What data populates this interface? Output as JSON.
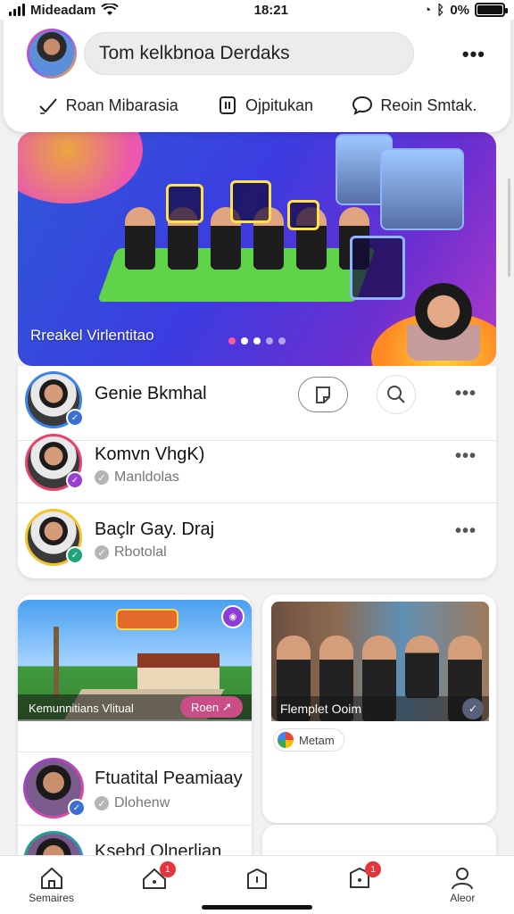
{
  "status_bar": {
    "carrier": "Mideadam",
    "time": "18:21",
    "battery": "0%"
  },
  "header": {
    "search_text": "Tom kelkbnoa Derdaks",
    "actions": [
      {
        "label": "Roan Mibarasia",
        "icon": "check-icon"
      },
      {
        "label": "Ojpitukan",
        "icon": "clipboard-icon"
      },
      {
        "label": "Reoin Smtak.",
        "icon": "chat-bubble-icon"
      }
    ]
  },
  "hero": {
    "caption": "Rreakel Virlentitao"
  },
  "contacts": [
    {
      "name": "Genie Bkmhal",
      "sub": "",
      "ring": "#3b83e6",
      "badge": "#3b6fd6"
    },
    {
      "name": "Komvn VhgK)",
      "sub": "Manldolas",
      "ring": "#e5436a",
      "badge": "#9b3ed6"
    },
    {
      "name": "Baçlr Gay. Draj",
      "sub": "Rbotolal",
      "ring": "#f2c22a",
      "badge": "#1ea67a"
    }
  ],
  "card_left": {
    "caption": "Kemunnitians Vlitual",
    "badge": "Roen",
    "row1_name": "Ftuatital Peamiaay",
    "row1_sub": "Dlohenw",
    "row2_name": "Ksebd Olnerlian"
  },
  "card_right": {
    "caption": "Flemplet Ooim",
    "chip": "Metam"
  },
  "tabs": [
    {
      "label": "Semaires",
      "icon": "home-icon",
      "badge": ""
    },
    {
      "label": "",
      "icon": "house-alert-icon",
      "badge": "1"
    },
    {
      "label": "",
      "icon": "bag-icon",
      "badge": ""
    },
    {
      "label": "",
      "icon": "package-icon",
      "badge": "1"
    },
    {
      "label": "Aleor",
      "icon": "profile-icon",
      "badge": ""
    }
  ],
  "colors": {
    "accent": "#3b6fd6",
    "badge_red": "#e5343c",
    "hero_start": "#2f58d8",
    "hero_end": "#b13acb"
  }
}
